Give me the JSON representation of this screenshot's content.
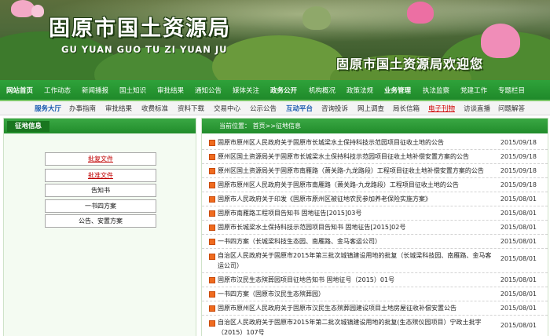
{
  "banner": {
    "title": "固原市国土资源局",
    "subtitle": "GU YUAN GUO TU ZI YUAN JU",
    "welcome": "固原市国土资源局欢迎您"
  },
  "nav_primary": [
    "网站首页",
    "工作动态",
    "新闻播报",
    "国土知识",
    "审批结果",
    "通知公告",
    "媒体关注",
    "政务公开",
    "机构概况",
    "政策法规",
    "业务管理",
    "执法监察",
    "党建工作",
    "专题栏目"
  ],
  "nav_secondary": [
    {
      "label": "服务大厅",
      "style": "strong"
    },
    {
      "label": "办事指南",
      "style": ""
    },
    {
      "label": "审批结果",
      "style": ""
    },
    {
      "label": "收费标准",
      "style": ""
    },
    {
      "label": "资料下载",
      "style": ""
    },
    {
      "label": "交易中心",
      "style": ""
    },
    {
      "label": "公示公告",
      "style": ""
    },
    {
      "label": "互动平台",
      "style": "strong"
    },
    {
      "label": "咨询投诉",
      "style": ""
    },
    {
      "label": "网上调查",
      "style": ""
    },
    {
      "label": "局长信箱",
      "style": ""
    },
    {
      "label": "电子刊物",
      "style": "red"
    },
    {
      "label": "访谈直播",
      "style": ""
    },
    {
      "label": "问题解答",
      "style": ""
    }
  ],
  "left_panel": {
    "title": "征地信息",
    "documents": [
      {
        "label": "批复文件",
        "style": "red"
      },
      {
        "label": "批准文件",
        "style": "red"
      },
      {
        "label": "告知书",
        "style": ""
      },
      {
        "label": "一书四方案",
        "style": ""
      },
      {
        "label": "公告、安置方案",
        "style": ""
      }
    ]
  },
  "right_panel": {
    "breadcrumb": "当前位置： 首页>>征地信息",
    "items": [
      {
        "title": "固原市原州区人民政府关于固原市长城梁水土保持科技示范园项目征收土地的公告",
        "date": "2015/09/18"
      },
      {
        "title": "原州区国土资源局关于固原市长城梁水土保持科技示范园项目征收土地补偿安置方案的公告",
        "date": "2015/09/18"
      },
      {
        "title": "原州区国土资源局关于固原市南雁路（萧关路-九龙路段）工程项目征收土地补偿安置方案的公告",
        "date": "2015/09/18"
      },
      {
        "title": "固原市原州区人民政府关于固原市南雁路（萧关路-九龙路段）工程项目征收土地的公告",
        "date": "2015/09/18"
      },
      {
        "title": "固原市人民政府关于印发《固原市原州区被征地农民参加养老保险实施方案》",
        "date": "2015/08/01"
      },
      {
        "title": "固原市南雁路工程项目告知书 固地征告[2015]03号",
        "date": "2015/08/01"
      },
      {
        "title": "固原市长城梁水土保持科技示范园项目告知书 固地征告[2015]02号",
        "date": "2015/08/01"
      },
      {
        "title": "一书四方案（长城梁科技生态园、南雁路、金马客运公司）",
        "date": "2015/08/01"
      },
      {
        "title": "自治区人民政府关于固原市2015年第三批次城镇建设用地的批复（长城梁科技园、南雁路、金马客运公司）",
        "date": "2015/08/01"
      },
      {
        "title": "固原市汉民生态殡葬园项目征地告知书 固地征号（2015）01号",
        "date": "2015/08/01"
      },
      {
        "title": "一书四方案（固原市汉民生态殡葬园）",
        "date": "2015/08/01"
      },
      {
        "title": "固原市原州区人民政府关于固原市汉民生态殡葬园建设项目土地房屋征收补偿安置公告",
        "date": "2015/08/01"
      },
      {
        "title": "自治区人民政府关于固原市2015年第二批次城镇建设用地的批复(生态殡仪园项目）宁政土批字（2015）107号",
        "date": "2015/08/01"
      }
    ]
  },
  "colors": {
    "nav_green": "#1f8a2a",
    "bullet_orange": "#ef6b1f",
    "link_red": "#c00000",
    "link_blue": "#1b5bb0"
  }
}
